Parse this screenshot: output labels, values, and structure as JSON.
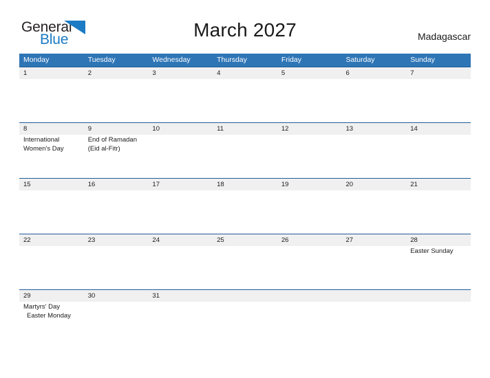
{
  "brand": {
    "name_part1": "General",
    "name_part2": "Blue",
    "color_dark": "#231f20",
    "color_blue": "#1b7bc4",
    "flag_icon": "blue-triangle-flag-icon"
  },
  "header": {
    "title": "March 2027",
    "country": "Madagascar"
  },
  "theme": {
    "header_blue": "#2e75b6",
    "date_band_gray": "#f0f0f0",
    "date_band_border": "#1f5c99",
    "text_color": "#1a1a1a"
  },
  "calendar": {
    "month": "March",
    "year": "2027",
    "weekday_headers": [
      "Monday",
      "Tuesday",
      "Wednesday",
      "Thursday",
      "Friday",
      "Saturday",
      "Sunday"
    ],
    "weeks": [
      {
        "dates": [
          "1",
          "2",
          "3",
          "4",
          "5",
          "6",
          "7"
        ],
        "events": [
          [],
          [],
          [],
          [],
          [],
          [],
          []
        ]
      },
      {
        "dates": [
          "8",
          "9",
          "10",
          "11",
          "12",
          "13",
          "14"
        ],
        "events": [
          [
            "International",
            "Women's Day"
          ],
          [
            "End of Ramadan",
            "(Eid al-Fitr)"
          ],
          [],
          [],
          [],
          [],
          []
        ]
      },
      {
        "dates": [
          "15",
          "16",
          "17",
          "18",
          "19",
          "20",
          "21"
        ],
        "events": [
          [],
          [],
          [],
          [],
          [],
          [],
          []
        ]
      },
      {
        "dates": [
          "22",
          "23",
          "24",
          "25",
          "26",
          "27",
          "28"
        ],
        "events": [
          [],
          [],
          [],
          [],
          [],
          [],
          [
            "Easter Sunday"
          ]
        ]
      },
      {
        "dates": [
          "29",
          "30",
          "31",
          "",
          "",
          "",
          ""
        ],
        "events": [
          [
            "Martyrs' Day",
            " Easter Monday"
          ],
          [],
          [],
          [],
          [],
          [],
          []
        ]
      }
    ],
    "holidays": [
      {
        "date": "8",
        "name": "International Women's Day"
      },
      {
        "date": "9",
        "name": "End of Ramadan (Eid al-Fitr)"
      },
      {
        "date": "28",
        "name": "Easter Sunday"
      },
      {
        "date": "29",
        "name": "Martyrs' Day"
      },
      {
        "date": "29",
        "name": "Easter Monday"
      }
    ]
  }
}
